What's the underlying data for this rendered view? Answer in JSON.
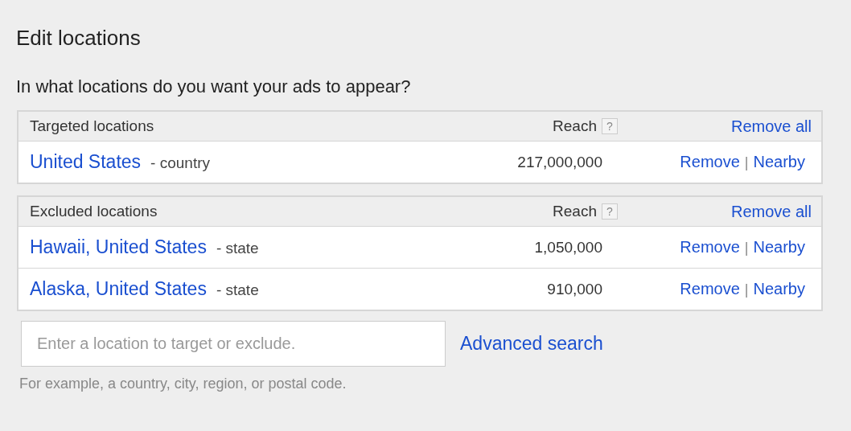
{
  "title": "Edit locations",
  "question": "In what locations do you want your ads to appear?",
  "sections": [
    {
      "heading": "Targeted locations",
      "reach_label": "Reach",
      "help": "?",
      "remove_all": "Remove all",
      "rows": [
        {
          "name": "United States",
          "type": "- country",
          "reach": "217,000,000",
          "remove": "Remove",
          "separator": "|",
          "nearby": "Nearby"
        }
      ]
    },
    {
      "heading": "Excluded locations",
      "reach_label": "Reach",
      "help": "?",
      "remove_all": "Remove all",
      "rows": [
        {
          "name": "Hawaii, United States",
          "type": "- state",
          "reach": "1,050,000",
          "remove": "Remove",
          "separator": "|",
          "nearby": "Nearby"
        },
        {
          "name": "Alaska, United States",
          "type": "- state",
          "reach": "910,000",
          "remove": "Remove",
          "separator": "|",
          "nearby": "Nearby"
        }
      ]
    }
  ],
  "search": {
    "placeholder": "Enter a location to target or exclude.",
    "advanced": "Advanced search",
    "hint": "For example, a country, city, region, or postal code."
  }
}
